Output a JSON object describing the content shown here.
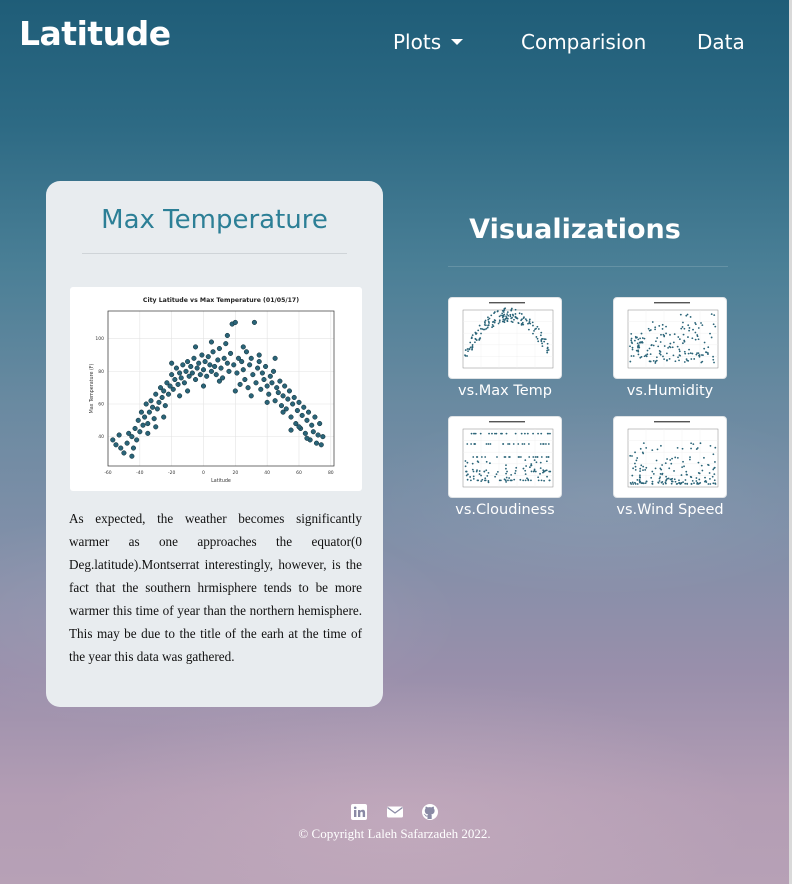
{
  "nav": {
    "brand": "Latitude",
    "plots_label": "Plots",
    "comparison_label": "Comparision",
    "data_label": "Data"
  },
  "card": {
    "title": "Max Temperature",
    "description": "As expected, the weather becomes significantly warmer as one approaches the equator(0 Deg.latitude).Montserrat interestingly, however, is the fact that the southern hrmisphere tends to be more warmer this time of year than the northern hemisphere. This may be due to the title of the earh at the time of the year this data was gathered."
  },
  "chart_data": {
    "type": "scatter",
    "title": "City Latitude vs Max Temperature (01/05/17)",
    "xlabel": "Latitude",
    "ylabel": "Max Temperature (F)",
    "xlim": [
      -60,
      82
    ],
    "ylim": [
      22,
      117
    ],
    "xticks": [
      -60,
      -40,
      -20,
      0,
      20,
      40,
      60,
      80
    ],
    "yticks": [
      40,
      60,
      80,
      100
    ],
    "grid": true,
    "point_color": "#2a6478",
    "points": [
      [
        -57,
        38
      ],
      [
        -55,
        35
      ],
      [
        -53,
        41
      ],
      [
        -50,
        30
      ],
      [
        -48,
        36
      ],
      [
        -47,
        42
      ],
      [
        -45,
        28
      ],
      [
        -44,
        33
      ],
      [
        -43,
        45
      ],
      [
        -42,
        38
      ],
      [
        -41,
        50
      ],
      [
        -40,
        43
      ],
      [
        -39,
        55
      ],
      [
        -38,
        47
      ],
      [
        -37,
        52
      ],
      [
        -36,
        60
      ],
      [
        -35,
        48
      ],
      [
        -34,
        55
      ],
      [
        -33,
        62
      ],
      [
        -32,
        58
      ],
      [
        -31,
        51
      ],
      [
        -30,
        66
      ],
      [
        -29,
        57
      ],
      [
        -28,
        61
      ],
      [
        -27,
        70
      ],
      [
        -26,
        64
      ],
      [
        -25,
        68
      ],
      [
        -24,
        59
      ],
      [
        -23,
        73
      ],
      [
        -22,
        66
      ],
      [
        -21,
        71
      ],
      [
        -20,
        78
      ],
      [
        -19,
        69
      ],
      [
        -18,
        75
      ],
      [
        -17,
        82
      ],
      [
        -16,
        72
      ],
      [
        -15,
        79
      ],
      [
        -14,
        76
      ],
      [
        -13,
        84
      ],
      [
        -12,
        73
      ],
      [
        -11,
        80
      ],
      [
        -10,
        86
      ],
      [
        -9,
        77
      ],
      [
        -8,
        83
      ],
      [
        -7,
        79
      ],
      [
        -6,
        88
      ],
      [
        -5,
        75
      ],
      [
        -4,
        82
      ],
      [
        -3,
        85
      ],
      [
        -2,
        78
      ],
      [
        -1,
        90
      ],
      [
        0,
        81
      ],
      [
        1,
        86
      ],
      [
        2,
        77
      ],
      [
        3,
        89
      ],
      [
        4,
        84
      ],
      [
        5,
        80
      ],
      [
        6,
        92
      ],
      [
        7,
        83
      ],
      [
        8,
        78
      ],
      [
        9,
        87
      ],
      [
        10,
        94
      ],
      [
        11,
        82
      ],
      [
        12,
        76
      ],
      [
        13,
        88
      ],
      [
        14,
        97
      ],
      [
        15,
        85
      ],
      [
        16,
        80
      ],
      [
        17,
        91
      ],
      [
        18,
        109
      ],
      [
        19,
        84
      ],
      [
        20,
        110
      ],
      [
        21,
        79
      ],
      [
        22,
        88
      ],
      [
        23,
        72
      ],
      [
        24,
        86
      ],
      [
        25,
        81
      ],
      [
        26,
        75
      ],
      [
        27,
        92
      ],
      [
        28,
        70
      ],
      [
        29,
        84
      ],
      [
        30,
        88
      ],
      [
        31,
        78
      ],
      [
        32,
        110
      ],
      [
        33,
        73
      ],
      [
        34,
        82
      ],
      [
        35,
        86
      ],
      [
        36,
        69
      ],
      [
        37,
        79
      ],
      [
        38,
        75
      ],
      [
        39,
        83
      ],
      [
        40,
        71
      ],
      [
        41,
        66
      ],
      [
        42,
        77
      ],
      [
        43,
        73
      ],
      [
        44,
        80
      ],
      [
        45,
        62
      ],
      [
        46,
        70
      ],
      [
        47,
        67
      ],
      [
        48,
        74
      ],
      [
        49,
        59
      ],
      [
        50,
        65
      ],
      [
        51,
        71
      ],
      [
        52,
        57
      ],
      [
        53,
        63
      ],
      [
        54,
        68
      ],
      [
        55,
        52
      ],
      [
        56,
        60
      ],
      [
        57,
        64
      ],
      [
        58,
        48
      ],
      [
        59,
        56
      ],
      [
        60,
        61
      ],
      [
        61,
        45
      ],
      [
        62,
        53
      ],
      [
        63,
        58
      ],
      [
        64,
        42
      ],
      [
        65,
        50
      ],
      [
        66,
        55
      ],
      [
        67,
        38
      ],
      [
        68,
        47
      ],
      [
        69,
        43
      ],
      [
        70,
        52
      ],
      [
        71,
        36
      ],
      [
        72,
        41
      ],
      [
        73,
        48
      ],
      [
        74,
        35
      ],
      [
        75,
        40
      ],
      [
        -35,
        42
      ],
      [
        -30,
        46
      ],
      [
        -25,
        52
      ],
      [
        -15,
        65
      ],
      [
        -10,
        68
      ],
      [
        0,
        71
      ],
      [
        10,
        74
      ],
      [
        20,
        68
      ],
      [
        30,
        65
      ],
      [
        40,
        61
      ],
      [
        50,
        55
      ],
      [
        60,
        46
      ],
      [
        15,
        102
      ],
      [
        25,
        95
      ],
      [
        -5,
        95
      ],
      [
        5,
        98
      ],
      [
        -20,
        85
      ],
      [
        35,
        90
      ],
      [
        45,
        88
      ],
      [
        -45,
        40
      ],
      [
        -52,
        33
      ],
      [
        55,
        44
      ],
      [
        65,
        39
      ]
    ]
  },
  "visualizations": {
    "title": "Visualizations",
    "items": [
      {
        "label": "vs.Max Temp"
      },
      {
        "label": "vs.Humidity"
      },
      {
        "label": "vs.Cloudiness"
      },
      {
        "label": "vs.Wind Speed"
      }
    ]
  },
  "footer": {
    "icons": [
      "linkedin-icon",
      "email-icon",
      "github-icon"
    ],
    "copyright": "© Copyright Laleh Safarzadeh 2022."
  }
}
